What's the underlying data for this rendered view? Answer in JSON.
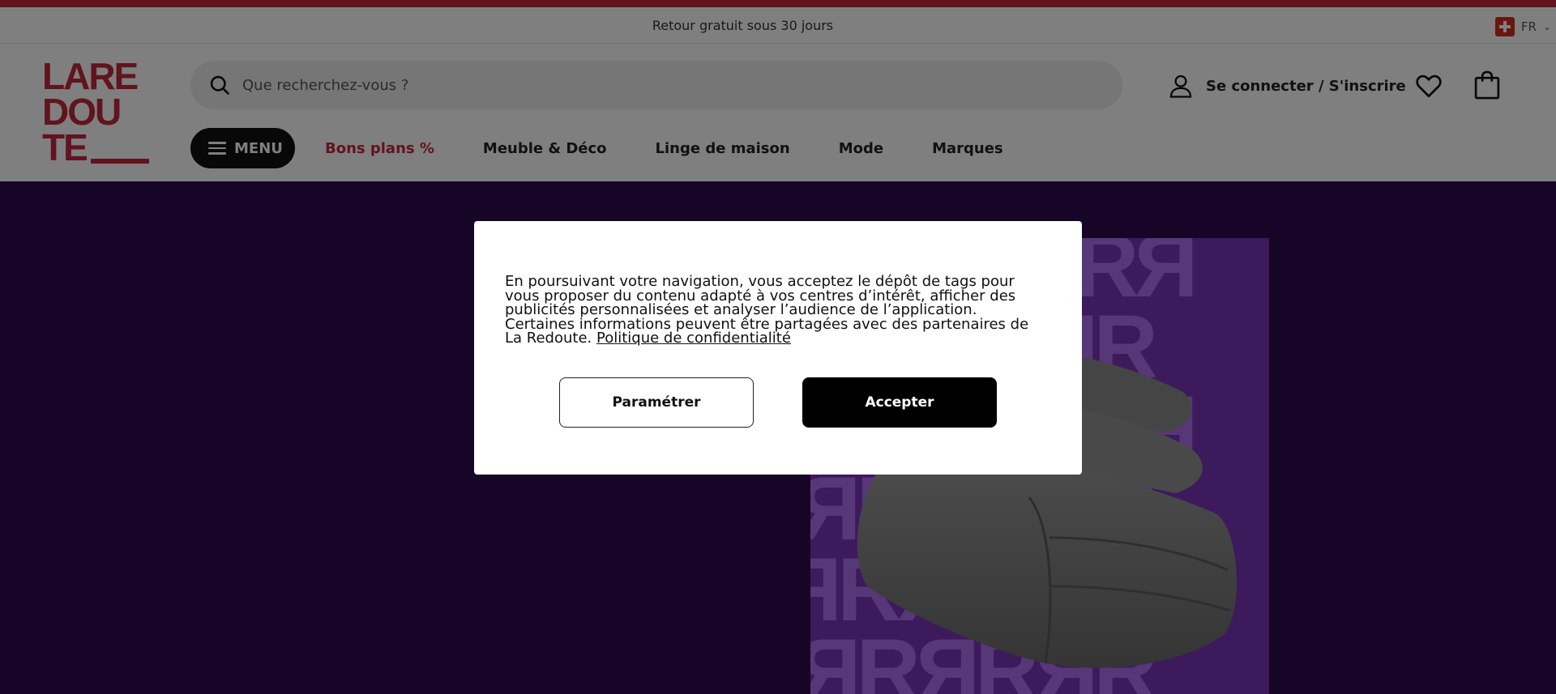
{
  "promo_bar": {
    "text": "Retour gratuit sous 30 jours",
    "locale": "FR"
  },
  "header": {
    "logo_lines": [
      "LARE",
      "DOU",
      "TE"
    ],
    "search": {
      "placeholder": "Que recherchez-vous ?"
    },
    "account_label": "Se connecter / S'inscrire",
    "menu_label": "MENU",
    "nav": [
      "Bons plans %",
      "Meuble & Déco",
      "Linge de maison",
      "Mode",
      "Marques"
    ]
  },
  "colors": {
    "brand_red": "#c2293c",
    "hero_bg": "#2f0a50",
    "pattern": "#7a35b8"
  },
  "cookie_modal": {
    "text": "En poursuivant votre navigation, vous acceptez le dépôt de tags pour vous proposer du contenu adapté à vos centres d’intérêt, afficher des publicités personnalisées et analyser l’audience de l’application. Certaines informations peuvent être partagées avec des partenaires de La Redoute.",
    "link": "Politique de confidentialité",
    "settings_button": "Paramétrer",
    "accept_button": "Accepter"
  }
}
